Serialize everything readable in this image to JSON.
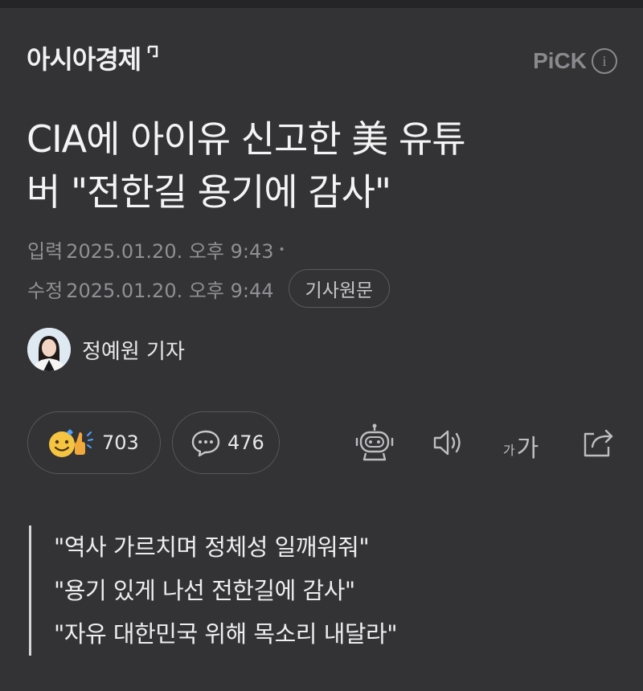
{
  "header": {
    "press_name": "아시아경제",
    "pick_label": "PiCK",
    "info_icon": "info-icon",
    "info_glyph": "i"
  },
  "article": {
    "headline_line1": "CIA에 아이유 신고한 美 유튜",
    "headline_line2": "버 \"전한길 용기에 감사\"",
    "input_label": "입력",
    "input_time": "2025.01.20. 오후 9:43",
    "edit_label": "수정",
    "edit_time": "2025.01.20. 오후 9:44",
    "original_button": "기사원문",
    "reporter": "정예원 기자",
    "quotes": [
      "\"역사 가르치며 정체성 일깨워줘\"",
      "\"용기 있게 나선 전한길에 감사\"",
      "\"자유 대한민국 위해 목소리 내달라\""
    ]
  },
  "actions": {
    "reaction_count": "703",
    "comment_count": "476",
    "font_small": "가",
    "font_large": "가",
    "icons": [
      "reaction-icon",
      "comment-icon",
      "robot-summary-icon",
      "speaker-icon",
      "font-size-icon",
      "share-icon"
    ]
  },
  "colors": {
    "background": "#333336",
    "text": "#f4f4f4",
    "muted": "#8f8f94",
    "accent_emoji": "#f5c542"
  }
}
